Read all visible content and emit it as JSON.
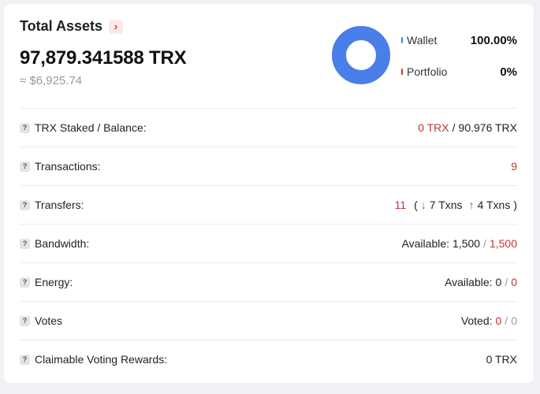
{
  "header": {
    "title": "Total Assets",
    "amount": "97,879.341588 TRX",
    "usd": "≈ $6,925.74",
    "arrow_icon": "chevron-right-icon"
  },
  "legend": [
    {
      "label": "Wallet",
      "value": "100.00%",
      "color": "#4a7ee8",
      "fraction": 1.0
    },
    {
      "label": "Portfolio",
      "value": "0%",
      "color": "#c23631",
      "fraction": 0.0
    }
  ],
  "rows": {
    "staked": {
      "label": "TRX Staked / Balance",
      "colon": ":",
      "staked": "0 TRX",
      "sep": "/",
      "balance": "90.976 TRX"
    },
    "transactions": {
      "label": "Transactions",
      "colon": ":",
      "value": "9"
    },
    "transfers": {
      "label": "Transfers",
      "colon": ":",
      "total": "11",
      "open": "(",
      "in_arrow": "↓",
      "in_txns": "7 Txns",
      "out_arrow": "↑",
      "out_txns": "4 Txns",
      "close": ")"
    },
    "bandwidth": {
      "label": "Bandwidth",
      "colon": ":",
      "prefix": "Available:",
      "available": "1,500",
      "sep": "/",
      "total": "1,500"
    },
    "energy": {
      "label": "Energy",
      "colon": ":",
      "prefix": "Available:",
      "available": "0",
      "sep": "/",
      "total": "0"
    },
    "votes": {
      "label": "Votes",
      "colon": "",
      "prefix": "Voted:",
      "voted": "0",
      "sep": "/",
      "total": "0"
    },
    "rewards": {
      "label": "Claimable Voting Rewards",
      "colon": ":",
      "value": "0 TRX"
    }
  },
  "help_icon_text": "?",
  "colors": {
    "accent_red": "#c23631",
    "wallet_blue": "#4a7ee8",
    "green": "#2e9e3e"
  }
}
